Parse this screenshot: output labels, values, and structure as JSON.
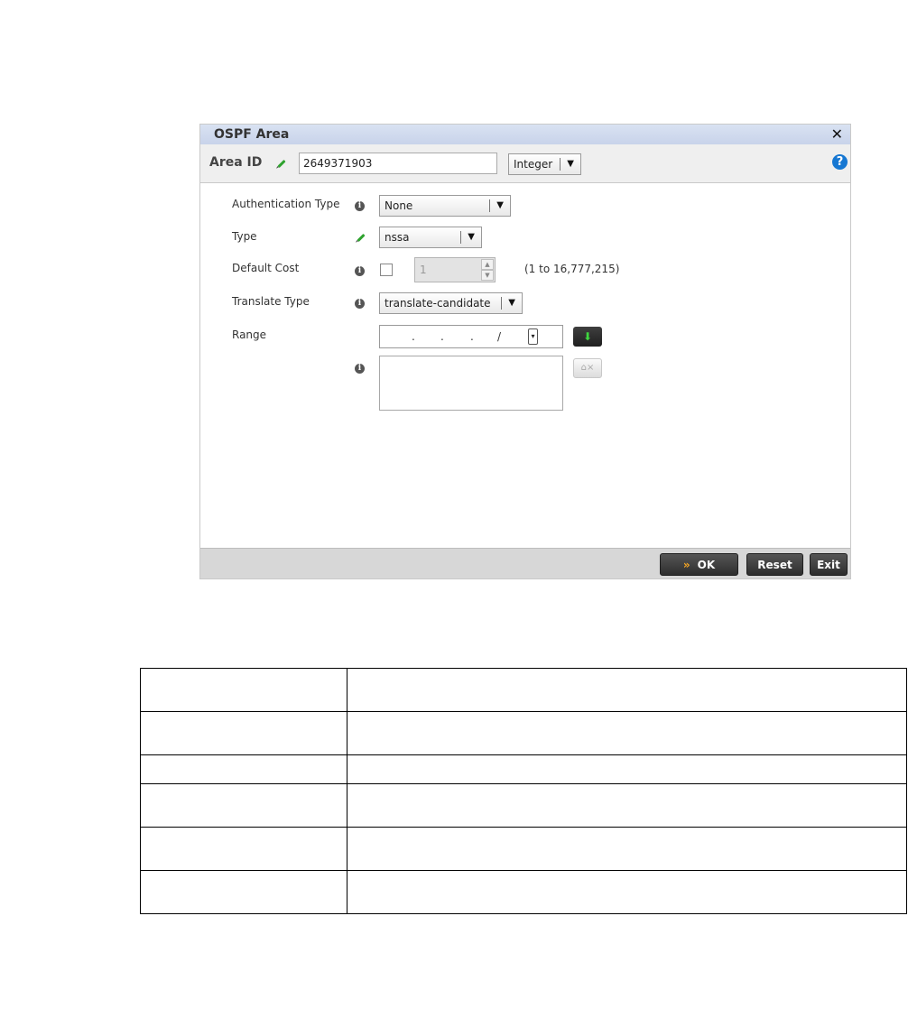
{
  "dialog": {
    "title": "OSPF Area",
    "area_id_label": "Area ID",
    "area_id_value": "2649371903",
    "area_id_type": "Integer"
  },
  "form": {
    "auth_label": "Authentication Type",
    "auth_value": "None",
    "type_label": "Type",
    "type_value": "nssa",
    "cost_label": "Default Cost",
    "cost_value": "1",
    "cost_hint": "(1 to 16,777,215)",
    "translate_label": "Translate Type",
    "translate_value": "translate-candidate",
    "range_label": "Range",
    "range_dot": ".",
    "range_slash": "/"
  },
  "footer": {
    "ok_label": "OK",
    "reset_label": "Reset",
    "exit_label": "Exit"
  },
  "icons": {
    "close": "close-icon",
    "help": "help-icon",
    "info": "info-icon",
    "edit": "pencil-icon",
    "add": "arrow-down-icon",
    "remove": "remove-icon"
  },
  "colors": {
    "titlebar": "#c8d3ea",
    "help": "#1677d2",
    "edit_pencil": "#2fa32f",
    "ok_chevron": "#f5a623",
    "button_dark": "#2e2e2e"
  }
}
